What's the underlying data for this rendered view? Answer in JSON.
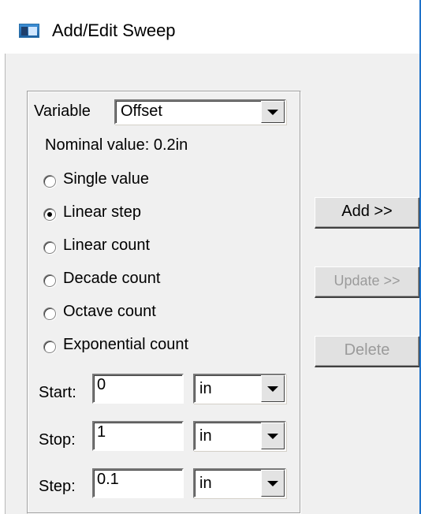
{
  "window": {
    "title": "Add/Edit Sweep",
    "icon": "app-window-icon"
  },
  "variable": {
    "label": "Variable",
    "selected": "Offset"
  },
  "nominal": {
    "text": "Nominal value:  0.2in"
  },
  "modes": [
    {
      "label": "Single value",
      "checked": false
    },
    {
      "label": "Linear step",
      "checked": true
    },
    {
      "label": "Linear count",
      "checked": false
    },
    {
      "label": "Decade count",
      "checked": false
    },
    {
      "label": "Octave count",
      "checked": false
    },
    {
      "label": "Exponential count",
      "checked": false
    }
  ],
  "fields": {
    "start": {
      "label": "Start:",
      "value": "0",
      "unit": "in"
    },
    "stop": {
      "label": "Stop:",
      "value": "1",
      "unit": "in"
    },
    "step": {
      "label": "Step:",
      "value": "0.1",
      "unit": "in"
    }
  },
  "buttons": {
    "add": "Add >>",
    "update": "Update >>",
    "delete": "Delete"
  }
}
